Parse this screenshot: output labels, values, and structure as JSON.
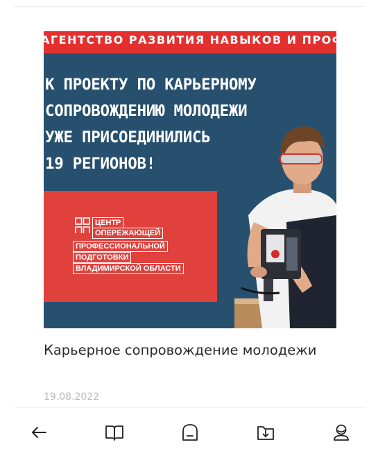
{
  "article": {
    "banner": {
      "top_strip": "АГЕНТСТВО РАЗВИТИЯ НАВЫКОВ И ПРОФЕССИЙ",
      "headline_lines": [
        "К ПРОЕКТУ ПО КАРЬЕРНОМУ",
        "СОПРОВОЖДЕНИЮ МОЛОДЕЖИ",
        "УЖЕ ПРИСОЕДИНИЛИСЬ",
        "19 РЕГИОНОВ!"
      ],
      "org_lines": [
        "ЦЕНТР",
        "ОПЕРЕЖАЮЩЕЙ",
        "ПРОФЕССИОНАЛЬНОЙ",
        "ПОДГОТОВКИ",
        "ВЛАДИМИРСКОЙ ОБЛАСТИ"
      ],
      "colors": {
        "blue": "#27506f",
        "red": "#e3302f"
      }
    },
    "title": "Карьерное сопровождение молодежи",
    "date": "19.08.2022"
  },
  "navbar": {
    "items": [
      {
        "icon": "back-arrow-icon"
      },
      {
        "icon": "book-icon"
      },
      {
        "icon": "home-icon"
      },
      {
        "icon": "download-folder-icon"
      },
      {
        "icon": "profile-icon"
      }
    ]
  }
}
